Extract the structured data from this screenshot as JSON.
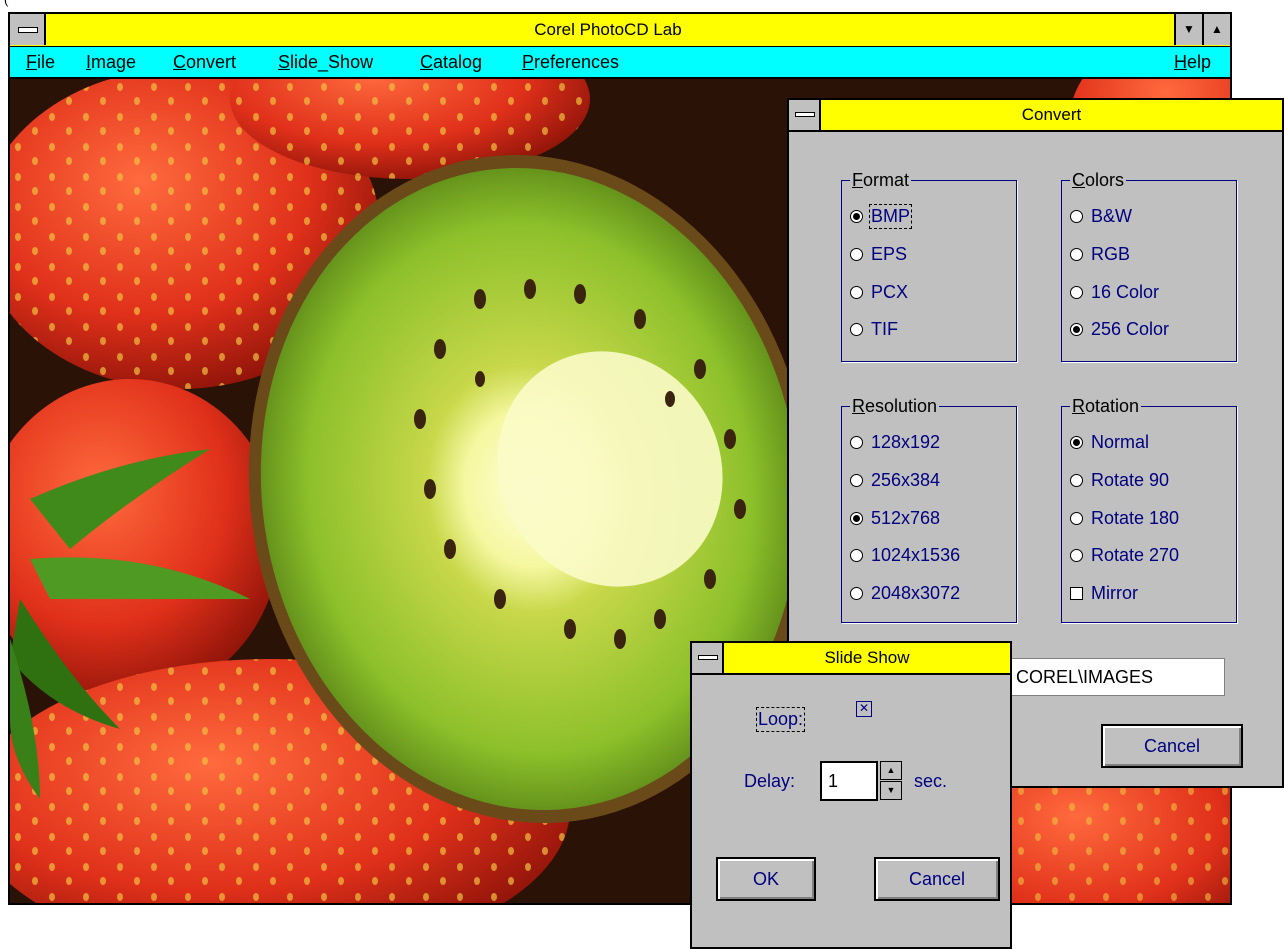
{
  "window": {
    "title": "Corel PhotoCD Lab",
    "min_glyph": "▼",
    "max_glyph": "▲"
  },
  "menu": [
    "File",
    "Image",
    "Convert",
    "Slide_Show",
    "Catalog",
    "Preferences",
    "Help"
  ],
  "convert_dialog": {
    "title": "Convert",
    "format": {
      "label": "Format",
      "options": [
        "BMP",
        "EPS",
        "PCX",
        "TIF"
      ],
      "selected": "BMP"
    },
    "colors": {
      "label": "Colors",
      "options": [
        "B&W",
        "RGB",
        "16 Color",
        "256 Color"
      ],
      "selected": "256 Color"
    },
    "resolution": {
      "label": "Resolution",
      "options": [
        "128x192",
        "256x384",
        "512x768",
        "1024x1536",
        "2048x3072"
      ],
      "selected": "512x768"
    },
    "rotation": {
      "label": "Rotation",
      "options": [
        "Normal",
        "Rotate 90",
        "Rotate 180",
        "Rotate 270"
      ],
      "selected": "Normal",
      "mirror_label": "Mirror",
      "mirror_checked": false
    },
    "path_value": "COREL\\IMAGES",
    "cancel_label": "Cancel"
  },
  "slideshow_dialog": {
    "title": "Slide Show",
    "loop_label": "Loop:",
    "loop_checked": true,
    "delay_label": "Delay:",
    "delay_value": "1",
    "delay_unit": "sec.",
    "ok_label": "OK",
    "cancel_label": "Cancel"
  },
  "colors": {
    "title_bar": "#ffff00",
    "menu_bar": "#00ffff",
    "dialog_face": "#c0c0c0",
    "label_text": "#000080"
  }
}
